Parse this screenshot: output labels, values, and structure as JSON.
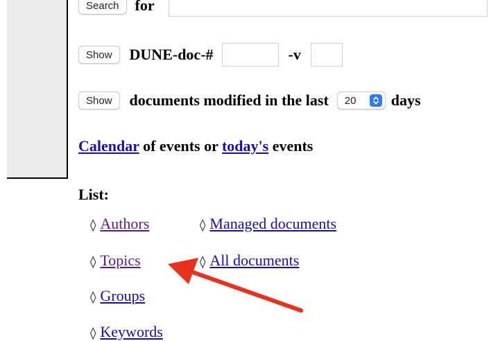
{
  "search_row": {
    "button_label": "Search",
    "label": "for"
  },
  "docnum_row": {
    "button_label": "Show",
    "label": "DUNE-doc-#",
    "version_label": "-v"
  },
  "modified_row": {
    "button_label": "Show",
    "label": "documents modified in the last",
    "days_value": "20",
    "suffix": "days"
  },
  "calendar_line": {
    "calendar_link": "Calendar",
    "middle_text": "of events or",
    "today_link": "today's",
    "end_text": "events"
  },
  "list": {
    "title": "List:",
    "bullet": "◊",
    "items": [
      {
        "label": "Authors"
      },
      {
        "label": "Managed documents"
      },
      {
        "label": "Topics"
      },
      {
        "label": "All documents"
      },
      {
        "label": "Groups"
      },
      {
        "label": "Keywords"
      }
    ]
  },
  "colors": {
    "link": "#1a0dab",
    "visited_link": "#551a8b",
    "annotation_arrow": "#e8321e",
    "select_stepper": "#2f7bf5"
  }
}
